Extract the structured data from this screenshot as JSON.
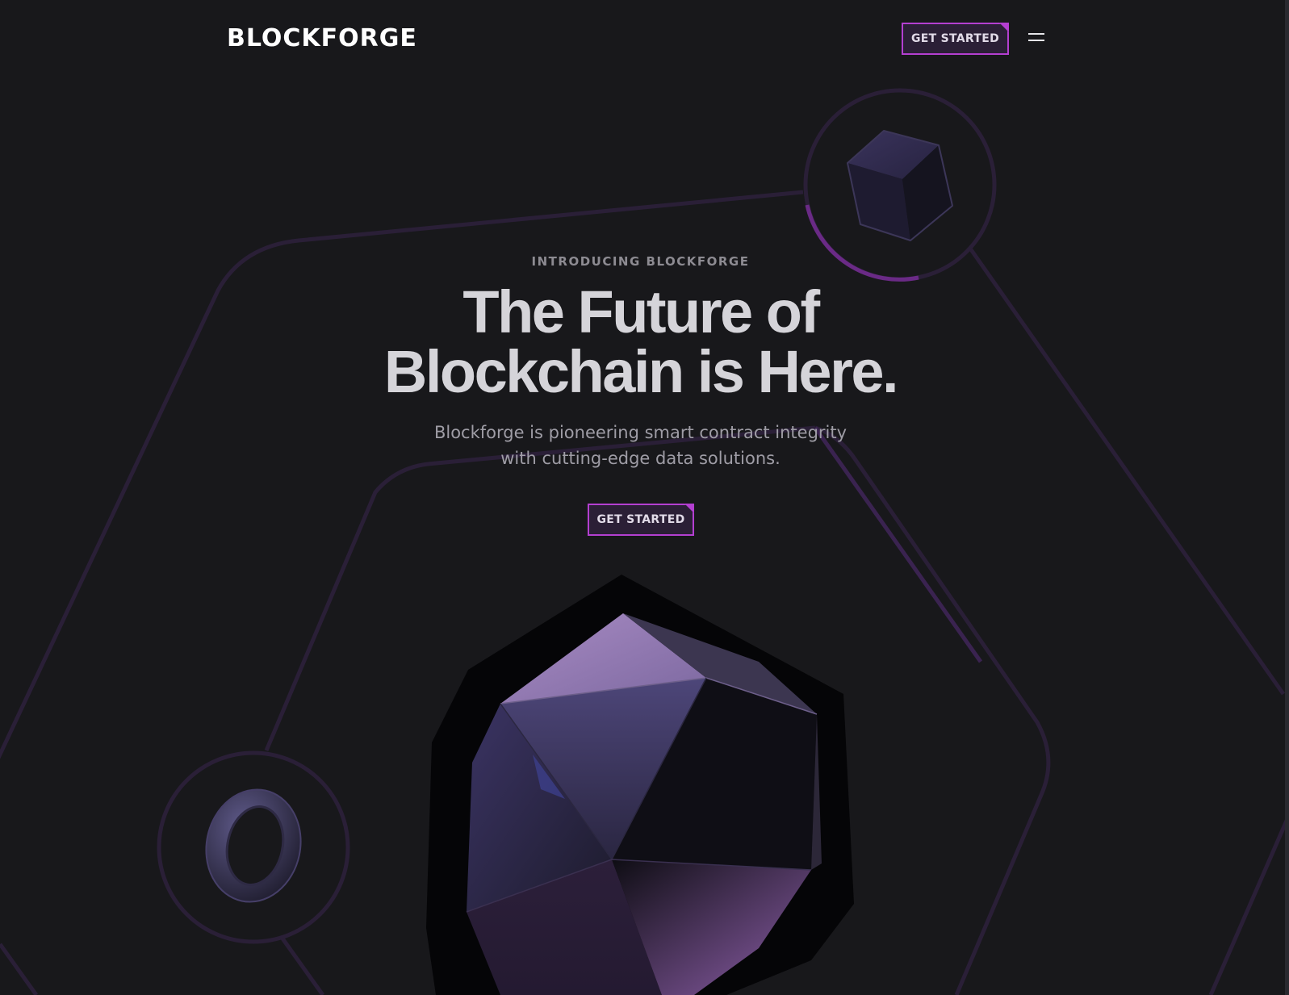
{
  "header": {
    "logo": "BLOCKFORGE",
    "cta_label": "GET STARTED"
  },
  "hero": {
    "eyebrow": "INTRODUCING BLOCKFORGE",
    "headline_line1": "The Future of",
    "headline_line2": "Blockchain is Here.",
    "subtitle_line1": "Blockforge is pioneering smart contract integrity",
    "subtitle_line2": "with cutting-edge data solutions.",
    "cta_label": "GET STARTED"
  },
  "icons": {
    "menu": "hamburger-menu-icon",
    "cube": "cube-3d-icon",
    "ring": "torus-ring-3d-icon",
    "gem": "icosahedron-3d-icon"
  },
  "colors": {
    "background": "#18181b",
    "accent": "#b43fd1",
    "line": "#2b1f38",
    "text": "#d5d4d9"
  }
}
